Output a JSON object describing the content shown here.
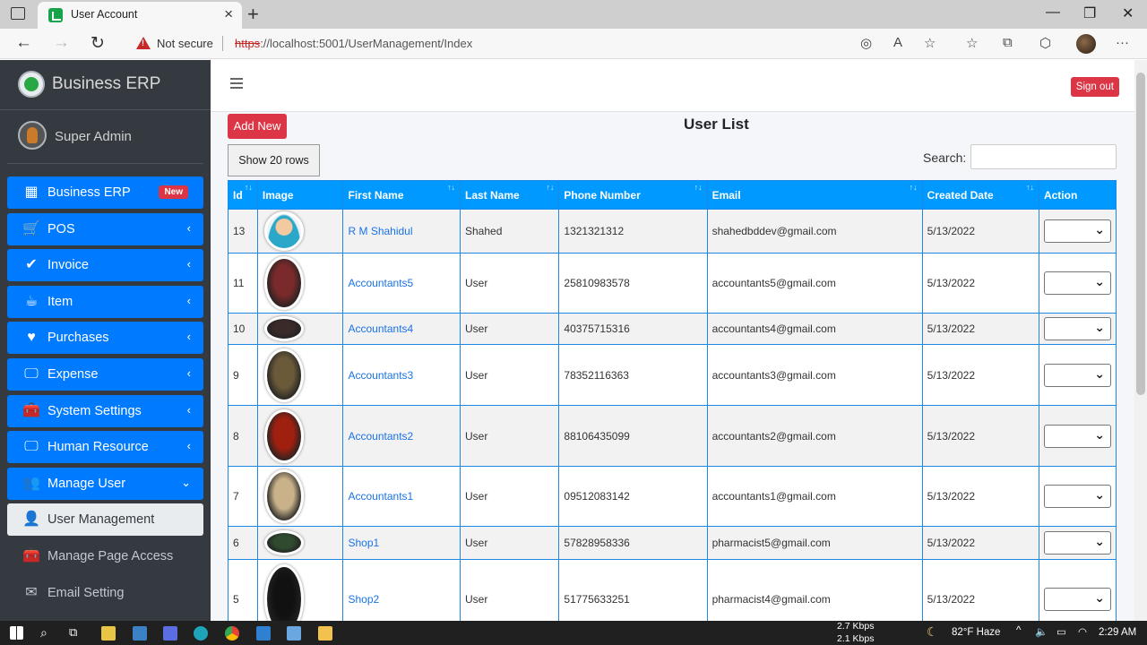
{
  "browser": {
    "tab_title": "User Account",
    "close_glyph": "×",
    "new_tab_glyph": "+",
    "not_secure": "Not secure",
    "url_scheme": "https",
    "url_rest": "://localhost:5001/UserManagement/Index",
    "back_glyph": "←",
    "forward_glyph": "→",
    "refresh_glyph": "↻",
    "minimize_glyph": "—",
    "restore_glyph": "❐",
    "close_window_glyph": "✕",
    "more_glyph": "···"
  },
  "sidebar": {
    "brand": "Business ERP",
    "user": "Super Admin",
    "items": [
      {
        "label": "Business ERP",
        "icon": "grid-icon",
        "glyph": "▦",
        "badge": "New",
        "style": "blue"
      },
      {
        "label": "POS",
        "icon": "cart-icon",
        "glyph": "🛒",
        "chevron": "‹",
        "style": "blue"
      },
      {
        "label": "Invoice",
        "icon": "check-circle-icon",
        "glyph": "✔",
        "chevron": "‹",
        "style": "blue"
      },
      {
        "label": "Item",
        "icon": "cup-icon",
        "glyph": "☕",
        "chevron": "‹",
        "style": "blue"
      },
      {
        "label": "Purchases",
        "icon": "heart-icon",
        "glyph": "♥",
        "chevron": "‹",
        "style": "blue"
      },
      {
        "label": "Expense",
        "icon": "desktop-icon",
        "glyph": "🖵",
        "chevron": "‹",
        "style": "blue"
      },
      {
        "label": "System Settings",
        "icon": "toolbox-icon",
        "glyph": "🧰",
        "chevron": "‹",
        "style": "blue"
      },
      {
        "label": "Human Resource",
        "icon": "desktop-icon",
        "glyph": "🖵",
        "chevron": "‹",
        "style": "blue"
      },
      {
        "label": "Manage User",
        "icon": "user-shield-icon",
        "glyph": "👥",
        "chevron": "⌄",
        "style": "blue"
      },
      {
        "label": "User Management",
        "icon": "user-shield-icon",
        "glyph": "👤",
        "style": "active-sub"
      },
      {
        "label": "Manage Page Access",
        "icon": "toolbox-icon",
        "glyph": "🧰",
        "style": "plain"
      },
      {
        "label": "Email Setting",
        "icon": "envelope-icon",
        "glyph": "✉",
        "style": "plain"
      }
    ]
  },
  "main": {
    "sign_out": "Sign out",
    "add_new": "Add New",
    "title": "User List",
    "show_rows": "Show 20 rows",
    "search_label": "Search:",
    "columns": [
      "Id",
      "Image",
      "First Name",
      "Last Name",
      "Phone Number",
      "Email",
      "Created Date",
      "Action"
    ],
    "rows": [
      {
        "id": "13",
        "first": "R M Shahidul",
        "last": "Shahed",
        "phone": "1321321312",
        "email": "shahedbddev@gmail.com",
        "date": "5/13/2022",
        "img": "default-avatar",
        "h": 49,
        "ih": 44
      },
      {
        "id": "11",
        "first": "Accountants5",
        "last": "User",
        "phone": "25810983578",
        "email": "accountants5@gmail.com",
        "date": "5/13/2022",
        "img": "photo",
        "h": 67,
        "ih": 60
      },
      {
        "id": "10",
        "first": "Accountants4",
        "last": "User",
        "phone": "40375715316",
        "email": "accountants4@gmail.com",
        "date": "5/13/2022",
        "img": "photo",
        "h": 35,
        "ih": 28
      },
      {
        "id": "9",
        "first": "Accountants3",
        "last": "User",
        "phone": "78352116363",
        "email": "accountants3@gmail.com",
        "date": "5/13/2022",
        "img": "photo",
        "h": 68,
        "ih": 60
      },
      {
        "id": "8",
        "first": "Accountants2",
        "last": "User",
        "phone": "88106435099",
        "email": "accountants2@gmail.com",
        "date": "5/13/2022",
        "img": "photo",
        "h": 68,
        "ih": 60
      },
      {
        "id": "7",
        "first": "Accountants1",
        "last": "User",
        "phone": "09512083142",
        "email": "accountants1@gmail.com",
        "date": "5/13/2022",
        "img": "photo",
        "h": 67,
        "ih": 60
      },
      {
        "id": "6",
        "first": "Shop1",
        "last": "User",
        "phone": "57828958336",
        "email": "pharmacist5@gmail.com",
        "date": "5/13/2022",
        "img": "photo",
        "h": 37,
        "ih": 28
      },
      {
        "id": "5",
        "first": "Shop2",
        "last": "User",
        "phone": "51775633251",
        "email": "pharmacist4@gmail.com",
        "date": "5/13/2022",
        "img": "photo",
        "h": 88,
        "ih": 78
      }
    ]
  },
  "taskbar": {
    "net_up": "2.7 Kbps",
    "net_down": "2.1 Kbps",
    "weather": "82°F  Haze",
    "time": "2:29 AM"
  }
}
